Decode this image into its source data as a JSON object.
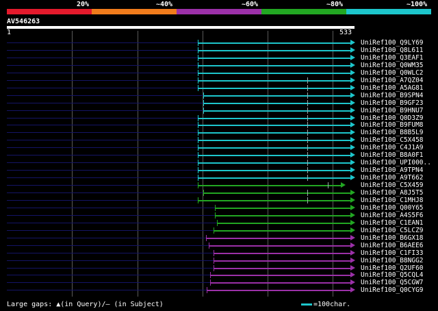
{
  "scale": {
    "labels": [
      "20%",
      "~40%",
      "~60%",
      "~80%",
      "~100%"
    ],
    "colors": [
      "#e41a2c",
      "#f07c1c",
      "#9b30a8",
      "#22a722",
      "#1dc6cc"
    ]
  },
  "query": {
    "name": "AV546263",
    "start": "1",
    "end": "533"
  },
  "legend": {
    "gaps_text": "Large gaps: ▲(in Query)/– (in Subject)",
    "scale_text": "=100char."
  },
  "hits": [
    {
      "label": "UniRef100_Q9LY69",
      "color": "cyan"
    },
    {
      "label": "UniRef100_Q8L611",
      "color": "cyan"
    },
    {
      "label": "UniRef100_Q3EAF1",
      "color": "cyan"
    },
    {
      "label": "UniRef100_Q0WM35",
      "color": "cyan"
    },
    {
      "label": "UniRef100_Q0WLC2",
      "color": "cyan"
    },
    {
      "label": "UniRef100_A7QZ04",
      "color": "cyan"
    },
    {
      "label": "UniRef100_A5AG81",
      "color": "cyan"
    },
    {
      "label": "UniRef100_B9SPN4",
      "color": "cyan"
    },
    {
      "label": "UniRef100_B9GF23",
      "color": "cyan"
    },
    {
      "label": "UniRef100_B9HNU7",
      "color": "cyan"
    },
    {
      "label": "UniRef100_Q0D3Z9",
      "color": "cyan"
    },
    {
      "label": "UniRef100_B9FUM8",
      "color": "cyan"
    },
    {
      "label": "UniRef100_B8B5L9",
      "color": "cyan"
    },
    {
      "label": "UniRef100_C5X458",
      "color": "cyan"
    },
    {
      "label": "UniRef100_C4J1A9",
      "color": "cyan"
    },
    {
      "label": "UniRef100_B8A0F1",
      "color": "cyan"
    },
    {
      "label": "UniRef100_UPI000..",
      "color": "cyan"
    },
    {
      "label": "UniRef100_A9TPN4",
      "color": "cyan"
    },
    {
      "label": "UniRef100_A9T662",
      "color": "cyan"
    },
    {
      "label": "UniRef100_C5X459",
      "color": "green"
    },
    {
      "label": "UniRef100_A8J5T5",
      "color": "green"
    },
    {
      "label": "UniRef100_C1MHJ8",
      "color": "green"
    },
    {
      "label": "UniRef100_Q00Y65",
      "color": "green"
    },
    {
      "label": "UniRef100_A4S5F6",
      "color": "green"
    },
    {
      "label": "UniRef100_C1EAN1",
      "color": "green"
    },
    {
      "label": "UniRef100_C5LCZ9",
      "color": "green"
    },
    {
      "label": "UniRef100_B6GX18",
      "color": "purple"
    },
    {
      "label": "UniRef100_B6AEE6",
      "color": "purple"
    },
    {
      "label": "UniRef100_C1FI33",
      "color": "purple"
    },
    {
      "label": "UniRef100_B8NGG2",
      "color": "purple"
    },
    {
      "label": "UniRef100_Q2UF60",
      "color": "purple"
    },
    {
      "label": "UniRef100_Q5CQL4",
      "color": "purple"
    },
    {
      "label": "UniRef100_Q5CGW7",
      "color": "purple"
    },
    {
      "label": "UniRef100_Q0CYG9",
      "color": "purple"
    }
  ],
  "colors": {
    "cyan": "#1dc6cc",
    "green": "#22a722",
    "purple": "#9b30a8",
    "navy": "#141466",
    "query_bar": "#ffffff"
  }
}
